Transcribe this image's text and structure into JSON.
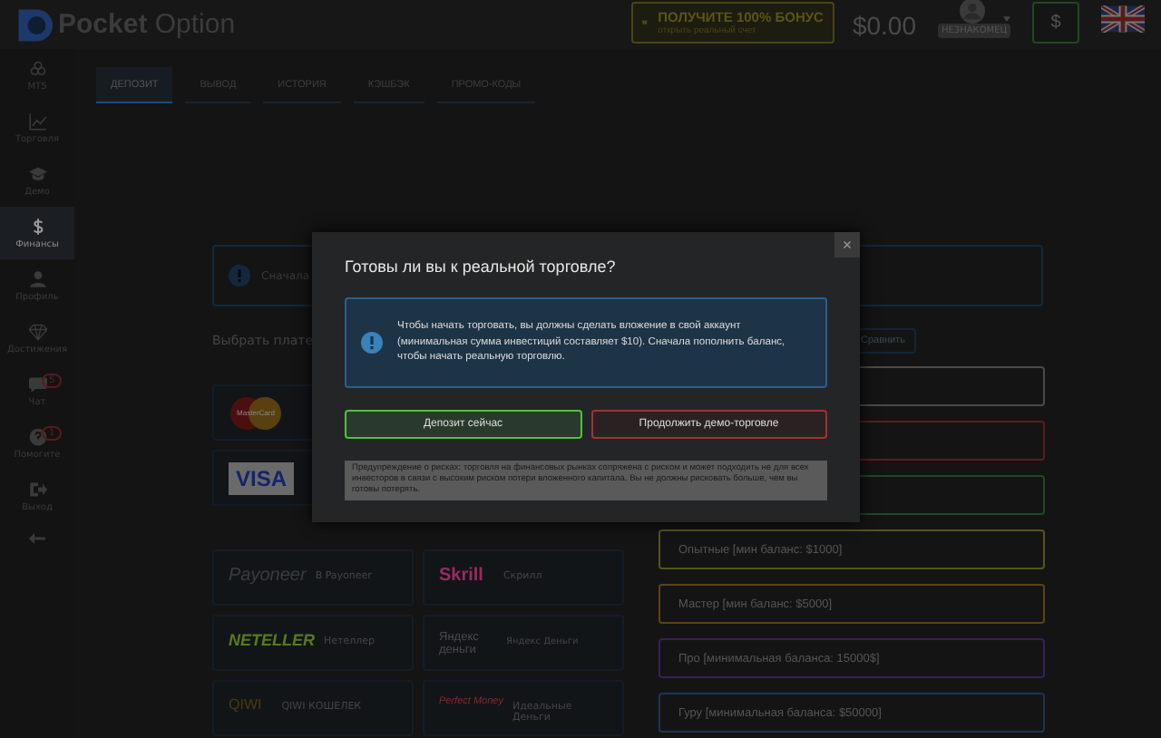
{
  "header": {
    "logo": "**Pocket** Option",
    "bonus": {
      "title": "ПОЛУЧИТЕ 100% БОНУС",
      "subtitle": "открыть реальный счет"
    },
    "balance": "$0.00",
    "user": "НЕЗНАКОМЕЦ",
    "currency": "$"
  },
  "sidebar": [
    {
      "kind": "mt5",
      "label": "MT5",
      "selected": false
    },
    {
      "kind": "chart",
      "label": "Торговля",
      "selected": false
    },
    {
      "kind": "cap",
      "label": "Демо",
      "selected": false
    },
    {
      "kind": "dollar",
      "label": "Финансы",
      "selected": true
    },
    {
      "kind": "person",
      "label": "Профиль",
      "selected": false
    },
    {
      "kind": "diamond",
      "label": "Достижения",
      "selected": false
    },
    {
      "kind": "chat",
      "label": "Чат",
      "selected": false,
      "badge": "5"
    },
    {
      "kind": "help",
      "label": "Помогите",
      "selected": false,
      "badge": "1"
    },
    {
      "kind": "exit",
      "label": "Выход",
      "selected": false
    }
  ],
  "tabs": [
    {
      "label": "ДЕПОЗИТ",
      "selected": true
    },
    {
      "label": "ВЫВОД",
      "selected": false
    },
    {
      "label": "ИСТОРИЯ",
      "selected": false
    },
    {
      "label": "КЭШБЭК",
      "selected": false
    },
    {
      "label": "ПРОМО-КОДЫ",
      "selected": false
    }
  ],
  "notice": "Сначала",
  "choose_label": "Выбрать плате",
  "compare_button": "Сравнить",
  "card_payments": [
    {
      "kind": "mastercard",
      "logo": "MasterCard"
    },
    {
      "kind": "visa",
      "logo": "VISA"
    }
  ],
  "e_payments": [
    {
      "kind": "payoneer",
      "logo": "Payoneer",
      "name": "В Payoneer"
    },
    {
      "kind": "skrill",
      "logo": "Skrill",
      "name": "Скрилл"
    },
    {
      "kind": "neteller",
      "logo": "NETELLER",
      "name": "Нетеллер"
    },
    {
      "kind": "yandex",
      "logo": "Яндекс деньги",
      "name": "Яндекс Деньги"
    },
    {
      "kind": "qiwi",
      "logo": "QIWI",
      "name": "QIWI КОШЕЛЕК"
    },
    {
      "kind": "perfect",
      "logo": "Perfect Money",
      "name": "Идеальные Деньги"
    }
  ],
  "levels": [
    {
      "color": "#4a4a4a"
    },
    {
      "color": "#5e1c1c"
    },
    {
      "color": "#1f4a22"
    },
    {
      "label": "Опытные [мин баланс: $1000]",
      "color": "#55551c"
    },
    {
      "label": "Мастер [мин баланс: $5000]",
      "color": "#5e4216"
    },
    {
      "label": "Про [минимальная баланса: 15000$]",
      "color": "#3a1f58"
    },
    {
      "label": "Гуру [минимальная баланса: $50000]",
      "color": "#1c3552"
    }
  ],
  "modal": {
    "title": "Готовы ли вы к реальной торговле?",
    "close": "×",
    "message": "Чтобы начать торговать, вы должны сделать вложение в свой аккаунт (минимальная сумма инвестиций составляет $10). Сначала пополнить баланс, чтобы начать реальную торговлю.",
    "buttons": [
      {
        "kind": "primary",
        "label": "Депозит сейчас"
      },
      {
        "kind": "secondary",
        "label": "Продолжить демо-торговле"
      }
    ],
    "warning": "Предупреждение о рисках: торговля на финансовых рынках сопряжена с риском и может подходить не для всех инвесторов в связи с высоким риском потери вложенного капитала. Вы не должны рисковать больше, чем вы готовы потерять."
  }
}
